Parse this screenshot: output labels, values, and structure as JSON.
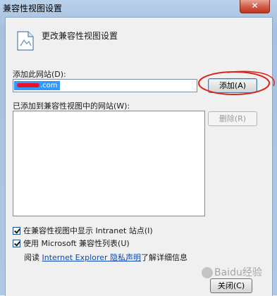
{
  "window": {
    "title": "兼容性视图设置",
    "close_glyph": "✕"
  },
  "header": {
    "text": "更改兼容性视图设置",
    "icon": "document-settings-icon"
  },
  "add_site": {
    "label": "添加此网站(D):",
    "value": ".com",
    "add_button": "添加(A)"
  },
  "list": {
    "label": "已添加到兼容性视图中的网站(W):",
    "items": [],
    "remove_button": "删除(R)"
  },
  "options": {
    "intranet": {
      "label": "在兼容性视图中显示 Intranet 站点(I)",
      "checked": true
    },
    "microsoft_list": {
      "label": "使用 Microsoft 兼容性列表(U)",
      "checked": true
    }
  },
  "privacy": {
    "prefix": "阅读",
    "link": "Internet Explorer 隐私声明",
    "suffix": "了解详细信息"
  },
  "footer": {
    "close_button": "关闭(C)"
  },
  "watermark": {
    "text": "Baidu经验"
  },
  "colors": {
    "annotation": "#d9261c",
    "selection": "#3399ff",
    "link": "#0a48b8"
  }
}
